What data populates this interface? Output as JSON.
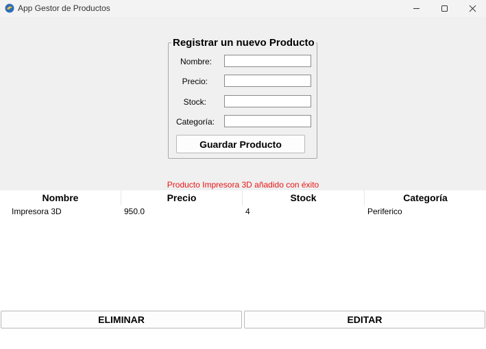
{
  "window": {
    "title": "App Gestor de Productos",
    "icon": "python-feather-icon"
  },
  "form": {
    "legend": "Registrar un nuevo Producto",
    "fields": [
      {
        "label": "Nombre:",
        "value": ""
      },
      {
        "label": "Precio:",
        "value": ""
      },
      {
        "label": "Stock:",
        "value": ""
      },
      {
        "label": "Categoría:",
        "value": ""
      }
    ],
    "save_label": "Guardar Producto"
  },
  "status_message": "Producto Impresora 3D añadido con éxito",
  "table": {
    "columns": [
      "Nombre",
      "Precio",
      "Stock",
      "Categoría"
    ],
    "rows": [
      [
        "Impresora 3D",
        "950.0",
        "4",
        "Periferico"
      ]
    ]
  },
  "actions": {
    "delete_label": "ELIMINAR",
    "edit_label": "EDITAR"
  },
  "colors": {
    "status_text": "#e81414",
    "window_bg": "#f0f0f0"
  }
}
